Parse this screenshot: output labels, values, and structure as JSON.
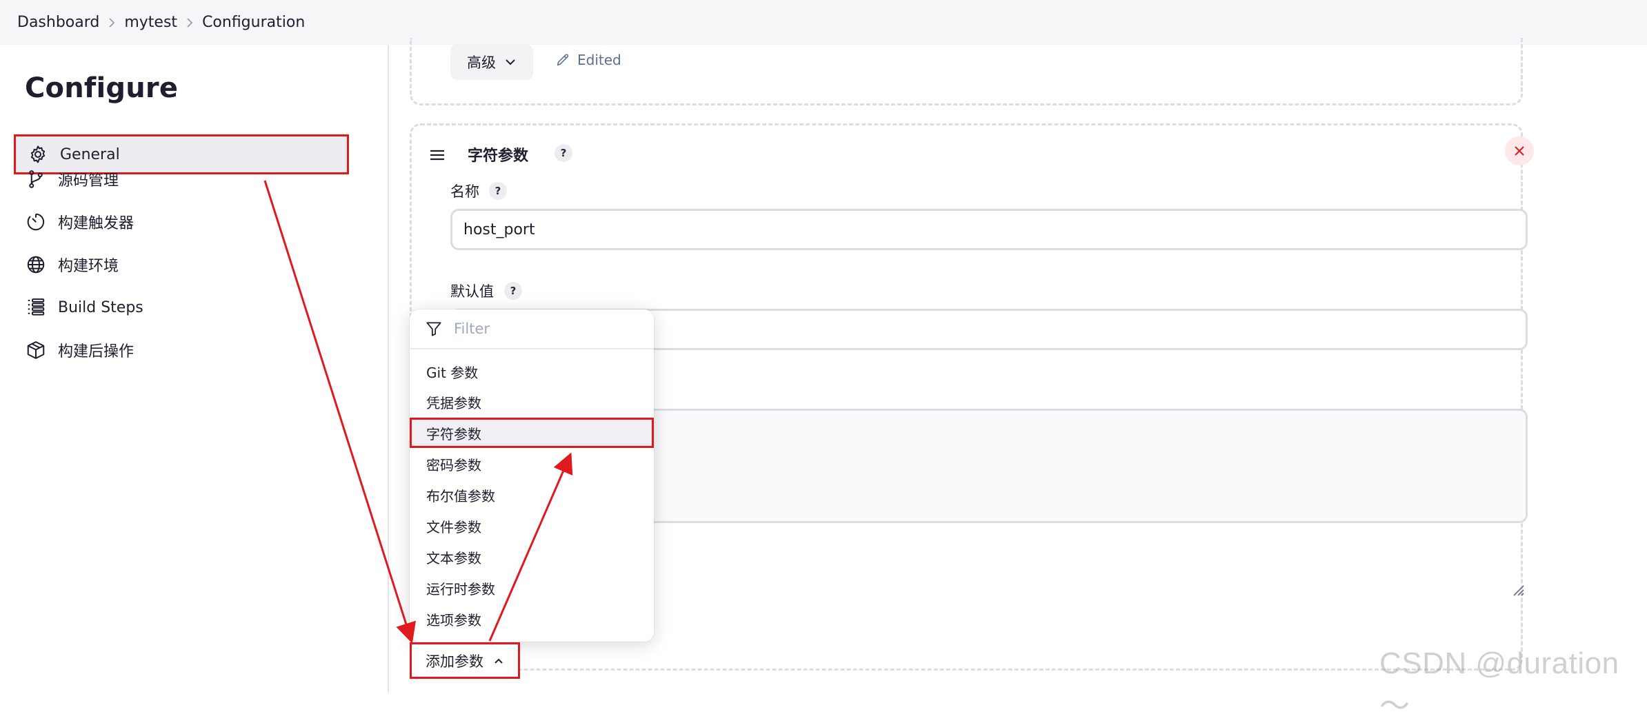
{
  "breadcrumb": {
    "items": [
      "Dashboard",
      "mytest",
      "Configuration"
    ]
  },
  "sidebar": {
    "title": "Configure",
    "items": [
      {
        "label": "General",
        "icon": "gear-icon",
        "active": true
      },
      {
        "label": "源码管理",
        "icon": "source-branch-icon",
        "active": false
      },
      {
        "label": "构建触发器",
        "icon": "timer-icon",
        "active": false
      },
      {
        "label": "构建环境",
        "icon": "globe-icon",
        "active": false
      },
      {
        "label": "Build Steps",
        "icon": "list-steps-icon",
        "active": false
      },
      {
        "label": "构建后操作",
        "icon": "package-icon",
        "active": false
      }
    ]
  },
  "advanced": {
    "label": "高级",
    "edited_label": "Edited"
  },
  "param_card": {
    "title": "字符参数",
    "help": "?",
    "name_label": "名称",
    "name_value": "host_port",
    "default_label": "默认值"
  },
  "dropdown": {
    "filter_placeholder": "Filter",
    "items": [
      "Git 参数",
      "凭据参数",
      "字符参数",
      "密码参数",
      "布尔值参数",
      "文件参数",
      "文本参数",
      "运行时参数",
      "选项参数"
    ],
    "highlighted_index": 2
  },
  "add_param": {
    "label": "添加参数"
  },
  "watermark": "CSDN @duration～",
  "colors": {
    "annotation_red": "#e0191f",
    "edited_blue": "#5b6f92",
    "breadcrumb_bg": "#f6f6f8"
  }
}
